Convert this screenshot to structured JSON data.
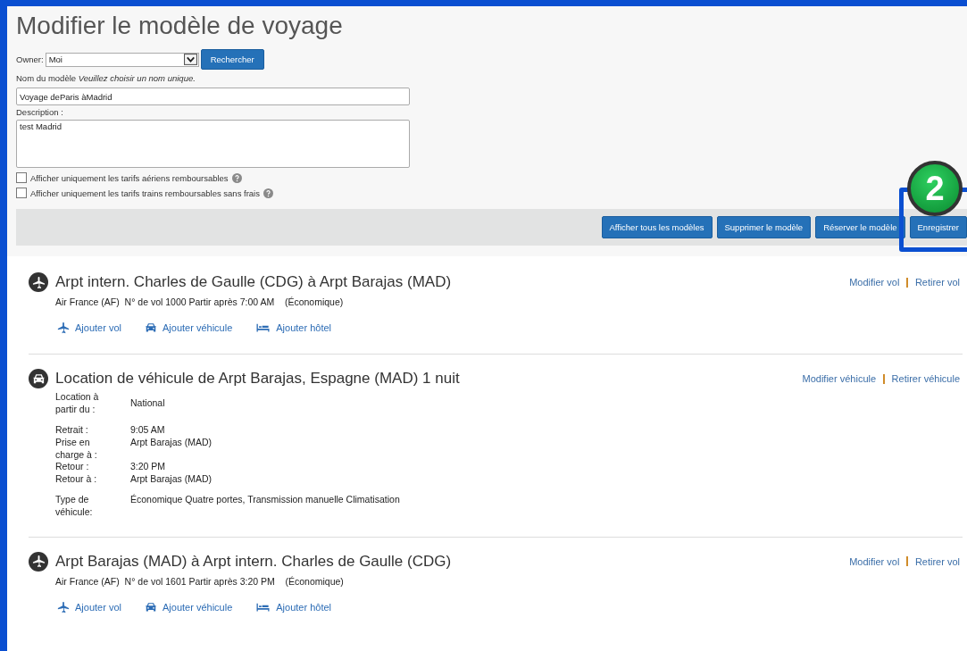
{
  "page_title": "Modifier le modèle de voyage",
  "owner": {
    "label": "Owner:",
    "value": "Moi",
    "search_button": "Rechercher"
  },
  "name_field": {
    "label": "Nom du modèle",
    "hint": "Veuillez choisir un nom unique.",
    "value": "Voyage deParis àMadrid"
  },
  "description_field": {
    "label": "Description :",
    "value": "test Madrid"
  },
  "options": [
    {
      "label": "Afficher uniquement les tarifs aériens remboursables",
      "checked": false
    },
    {
      "label": "Afficher uniquement les tarifs trains remboursables sans frais",
      "checked": false
    }
  ],
  "actions": [
    {
      "label": "Afficher tous les modèles",
      "highlighted": false
    },
    {
      "label": "Supprimer le modèle",
      "highlighted": false
    },
    {
      "label": "Réserver le modèle",
      "highlighted": false
    },
    {
      "label": "Enregistrer",
      "highlighted": true
    }
  ],
  "step_badge": "2",
  "segments": [
    {
      "kind": "flight",
      "title": "Arpt intern. Charles de Gaulle (CDG) à Arpt Barajas (MAD)",
      "details": "Air France (AF)  N° de vol 1000 Partir après 7:00 AM    (Économique)",
      "modify": "Modifier vol",
      "remove": "Retirer vol",
      "add_links": [
        {
          "kind": "flight",
          "label": "Ajouter vol"
        },
        {
          "kind": "car",
          "label": "Ajouter véhicule"
        },
        {
          "kind": "hotel",
          "label": "Ajouter hôtel"
        }
      ]
    },
    {
      "kind": "car",
      "title": "Location de véhicule de Arpt Barajas, Espagne (MAD) 1 nuit",
      "modify": "Modifier véhicule",
      "remove": "Retirer véhicule",
      "detail_groups": [
        {
          "rows": [
            {
              "label": "Location à partir du :",
              "value": "National"
            }
          ]
        },
        {
          "rows": [
            {
              "label": "Retrait :",
              "value": "9:05 AM"
            },
            {
              "label": "Prise en charge à :",
              "value": "Arpt Barajas (MAD)"
            },
            {
              "label": "Retour :",
              "value": "3:20 PM"
            },
            {
              "label": "Retour à :",
              "value": "Arpt Barajas (MAD)"
            }
          ]
        },
        {
          "rows": [
            {
              "label": "Type de véhicule:",
              "value": "Économique Quatre portes, Transmission manuelle Climatisation"
            }
          ]
        }
      ]
    },
    {
      "kind": "flight",
      "title": "Arpt Barajas (MAD) à Arpt intern. Charles de Gaulle (CDG)",
      "details": "Air France (AF)  N° de vol 1601 Partir après 3:20 PM    (Économique)",
      "modify": "Modifier vol",
      "remove": "Retirer vol",
      "add_links": [
        {
          "kind": "flight",
          "label": "Ajouter vol"
        },
        {
          "kind": "car",
          "label": "Ajouter véhicule"
        },
        {
          "kind": "hotel",
          "label": "Ajouter hôtel"
        }
      ]
    }
  ]
}
